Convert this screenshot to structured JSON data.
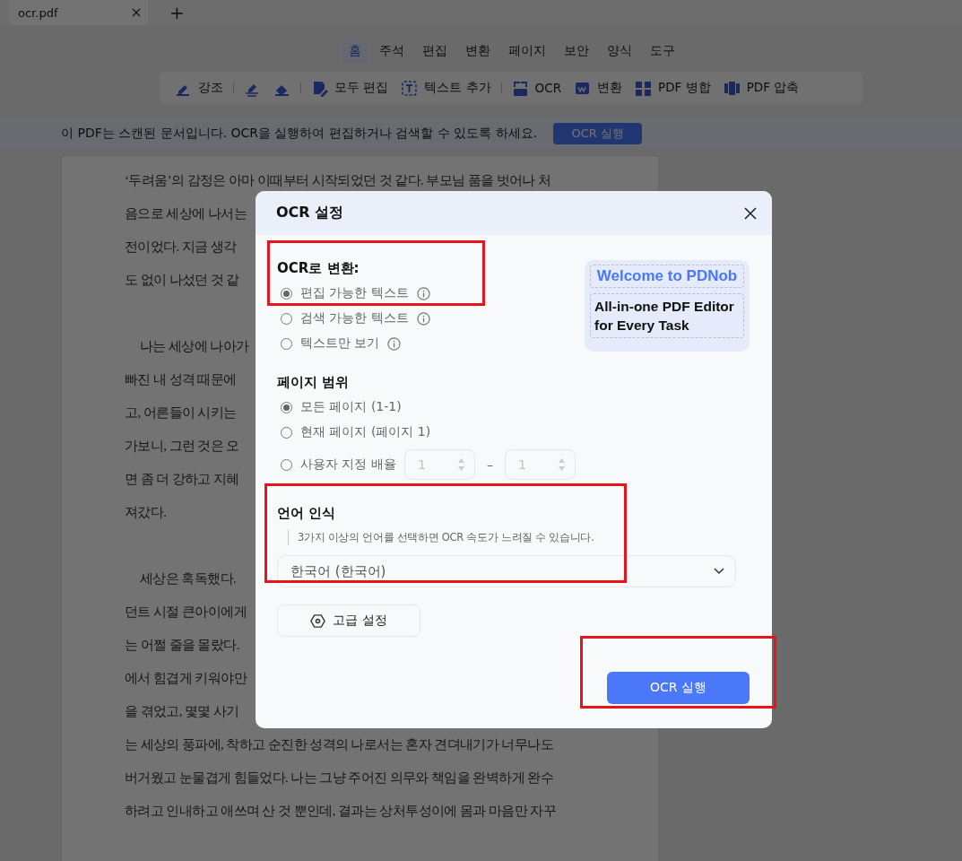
{
  "tabs": [
    {
      "label": "ocr.pdf",
      "selected": true
    }
  ],
  "new_tab": "+",
  "menu": [
    {
      "label": "홈",
      "selected": true
    },
    {
      "label": "주석",
      "selected": false
    },
    {
      "label": "편집",
      "selected": false
    },
    {
      "label": "변환",
      "selected": false
    },
    {
      "label": "페이지",
      "selected": false
    },
    {
      "label": "보안",
      "selected": false
    },
    {
      "label": "양식",
      "selected": false
    },
    {
      "label": "도구",
      "selected": false
    }
  ],
  "toolbar": [
    [
      {
        "kind": "highlight",
        "label": "강조"
      }
    ],
    [
      {
        "kind": "marker"
      },
      {
        "kind": "eraser"
      }
    ],
    [
      {
        "kind": "edit",
        "label": "모두 편집"
      },
      {
        "kind": "text",
        "label": "텍스트 추가"
      }
    ],
    [
      {
        "kind": "ocr",
        "label": "OCR"
      },
      {
        "kind": "convert",
        "label": "변환"
      },
      {
        "kind": "merge",
        "label": "PDF 병합"
      },
      {
        "kind": "compress",
        "label": "PDF 압축"
      }
    ]
  ],
  "banner": {
    "text": "이 PDF는 스캔된 문서입니다. OCR을 실행하여 편집하거나 검색할 수 있도록 하세요.",
    "button": "OCR 실행"
  },
  "document": {
    "paragraphs": [
      {
        "indented": false,
        "lines": [
          "‘두려움’의 감정은 아마 이때부터 시작되었던 것 같다. 부모님 품을 벗어나 처",
          "음으로 세상에 나서는",
          "전이었다. 지금 생각",
          "도 없이 나섰던 것 같"
        ]
      },
      {
        "indented": true,
        "lines": [
          "나는 세상에 나아가",
          "빠진 내 성격 때문에",
          "고, 어른들이 시키는",
          "가보니, 그런 것은 오",
          "면 좀 더 강하고 지혜",
          "져갔다."
        ]
      },
      {
        "indented": true,
        "lines": [
          "세상은 혹독했다.",
          "던트 시절 큰아이에게",
          "는 어쩔 줄을 몰랐다.",
          "에서 힘겹게 키워야만",
          "을 겪었고, 몇몇 사기",
          "는 세상의 풍파에, 착하고 순진한 성격의 나로서는 혼자 견뎌내기가 너무나도",
          "버거웠고 눈물겹게 힘들었다. 나는 그냥 주어진 의무와 책임을 완벽하게 완수",
          "하려고 인내하고 애쓰며 산 것 뿐인데, 결과는 상처투성이에 몸과 마음만 자꾸"
        ]
      }
    ]
  },
  "dialog": {
    "title": "OCR 설정",
    "convert": {
      "heading": "OCR로 변환:",
      "options": [
        {
          "label": "편집 가능한 텍스트",
          "selected": true,
          "info": true
        },
        {
          "label": "검색 가능한 텍스트",
          "selected": false,
          "info": true
        },
        {
          "label": "텍스트만 보기",
          "selected": false,
          "info": true
        }
      ]
    },
    "promo": {
      "title": "Welcome to PDNob",
      "subtitle": "All-in-one PDF Editor for Every Task"
    },
    "page_range": {
      "heading": "페이지 범위",
      "options": [
        {
          "label": "모든 페이지 (1-1)",
          "selected": true,
          "kind": "plain"
        },
        {
          "label": "현재 페이지 (페이지 1)",
          "selected": false,
          "kind": "plain"
        },
        {
          "label": "사용자 지정 배율",
          "selected": false,
          "kind": "range"
        }
      ],
      "from": "1",
      "to": "1",
      "dash": "–",
      "disabled": true
    },
    "language": {
      "heading": "언어 인식",
      "note": "3가지 이상의 언어를 선택하면 OCR 속도가 느려질 수 있습니다.",
      "value": "한국어 (한국어)"
    },
    "advanced_button": "고급 설정",
    "run_button": "OCR 실행"
  }
}
